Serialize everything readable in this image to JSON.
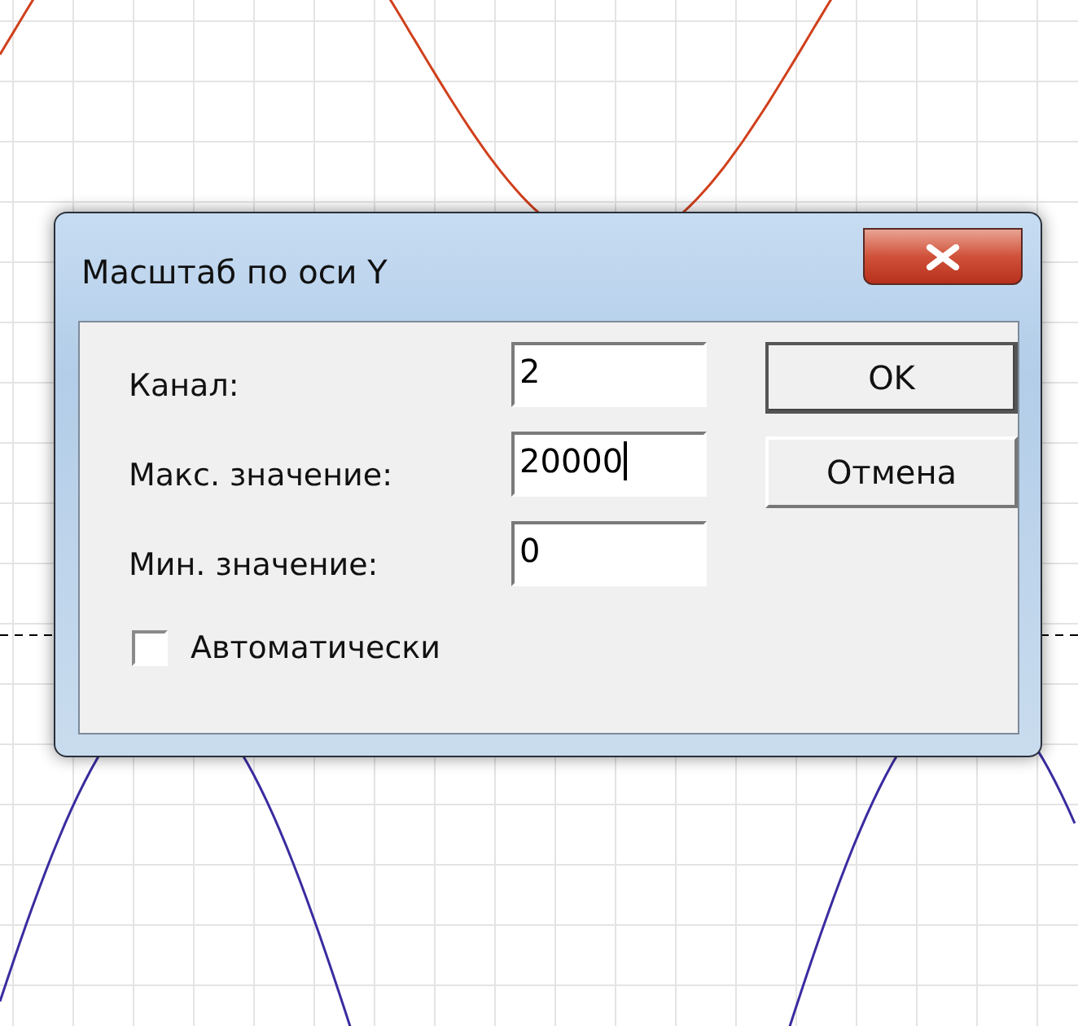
{
  "window": {
    "title": "Масштаб по оси Y"
  },
  "fields": [
    {
      "label": "Канал:",
      "value": "2",
      "focused": false
    },
    {
      "label": "Макс. значение:",
      "value": "20000",
      "focused": true
    },
    {
      "label": "Мин. значение:",
      "value": "0",
      "focused": false
    }
  ],
  "checkbox": {
    "label": "Автоматически",
    "checked": false
  },
  "buttons": [
    {
      "label": "OK",
      "default": true
    },
    {
      "label": "Отмена",
      "default": false
    }
  ]
}
